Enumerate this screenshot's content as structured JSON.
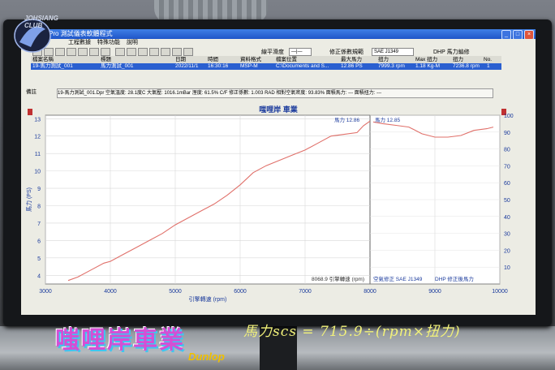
{
  "window": {
    "title": "Pro 測試儀表軟體程式",
    "menu": [
      "工程數據",
      "特殊功能",
      "說明"
    ]
  },
  "toolbar": {
    "smooth_label": "線平滑度",
    "correction_label": "修正係數規範",
    "correction_value": "SAE J1349",
    "dhp_label": "DHP 馬力編修"
  },
  "table": {
    "headers": [
      "檔案名稱",
      "標題",
      "日期",
      "時間",
      "資料格式",
      "檔案位置",
      "最大馬力",
      "扭力",
      "Max 扭力",
      "扭力",
      "No."
    ],
    "row": [
      "19-馬力測試_001",
      "馬力測試_001",
      "2022/11/1",
      "16:30:16",
      "MSP-M",
      "C:\\Documents and S...",
      "12.86 PS",
      "7999.3 rpm",
      "1.18 Kg-M",
      "7236.8 rpm",
      "1"
    ]
  },
  "info": {
    "label": "備註",
    "text": "19-馬力測試_001.Dpr   空氣溫度: 28.1度C   大氣壓: 1016.1mBar   溼度: 61.5%   C/F 修正係數: 1.003   RAD 相對空氣密度: 93.83%   面積馬力: ---   面積扭力: ---"
  },
  "chart_data": {
    "type": "line",
    "title": "嗤哩岸 車業",
    "left_chart": {
      "xlabel": "引擎轉速 (rpm)",
      "ylabel": "馬力 (PS)",
      "xlim": [
        3000,
        8000
      ],
      "ylim": [
        3.5,
        13.2
      ],
      "x_ticks": [
        "3000",
        "4000",
        "5000",
        "6000",
        "7000",
        "8000"
      ],
      "y_ticks": [
        "4",
        "5",
        "6",
        "7",
        "8",
        "9",
        "10",
        "11",
        "12",
        "13"
      ],
      "series": [
        {
          "name": "馬力",
          "x": [
            3350,
            3500,
            3700,
            3900,
            4000,
            4200,
            4400,
            4600,
            4800,
            5000,
            5200,
            5400,
            5600,
            5800,
            6000,
            6200,
            6400,
            6600,
            6800,
            7000,
            7200,
            7400,
            7600,
            7800,
            7900,
            8000
          ],
          "y": [
            3.7,
            3.9,
            4.3,
            4.7,
            4.8,
            5.2,
            5.6,
            6.0,
            6.4,
            6.9,
            7.3,
            7.7,
            8.1,
            8.6,
            9.2,
            9.9,
            10.3,
            10.6,
            10.9,
            11.2,
            11.6,
            12.0,
            12.1,
            12.2,
            12.6,
            12.86
          ]
        }
      ],
      "annotations": [
        "馬力 12.86",
        "8068.9 引擎轉速 (rpm)"
      ]
    },
    "right_chart": {
      "xlim": [
        8000,
        10000
      ],
      "ylim": [
        0,
        100
      ],
      "x_ticks": [
        "9000",
        "10000"
      ],
      "y_ticks": [
        "10",
        "20",
        "30",
        "40",
        "50",
        "60",
        "70",
        "80",
        "90",
        "100"
      ],
      "series": [
        {
          "name": "馬力",
          "x": [
            8050,
            8200,
            8400,
            8600,
            8800,
            9000,
            9200,
            9400,
            9600,
            9800,
            9900
          ],
          "y": [
            96,
            95,
            94,
            93,
            89,
            87,
            87,
            88,
            91,
            92,
            93
          ]
        }
      ],
      "annotations": [
        "馬力 12.85",
        "空氣修正 SAE J1349",
        "DHP 修正後馬力"
      ]
    }
  },
  "overlay": {
    "logo_text": "JOHSIANG CLUB",
    "sticker_text": "嗤哩岸車業",
    "handwriting": "馬力scs = 715.9÷(rpm×扭力)",
    "base_label": "Dunlop"
  },
  "colors": {
    "curve": "#e0706a",
    "title_text": "#1a3a9c",
    "axis_text": "#1a3a9c",
    "selection": "#2a5fd0"
  }
}
